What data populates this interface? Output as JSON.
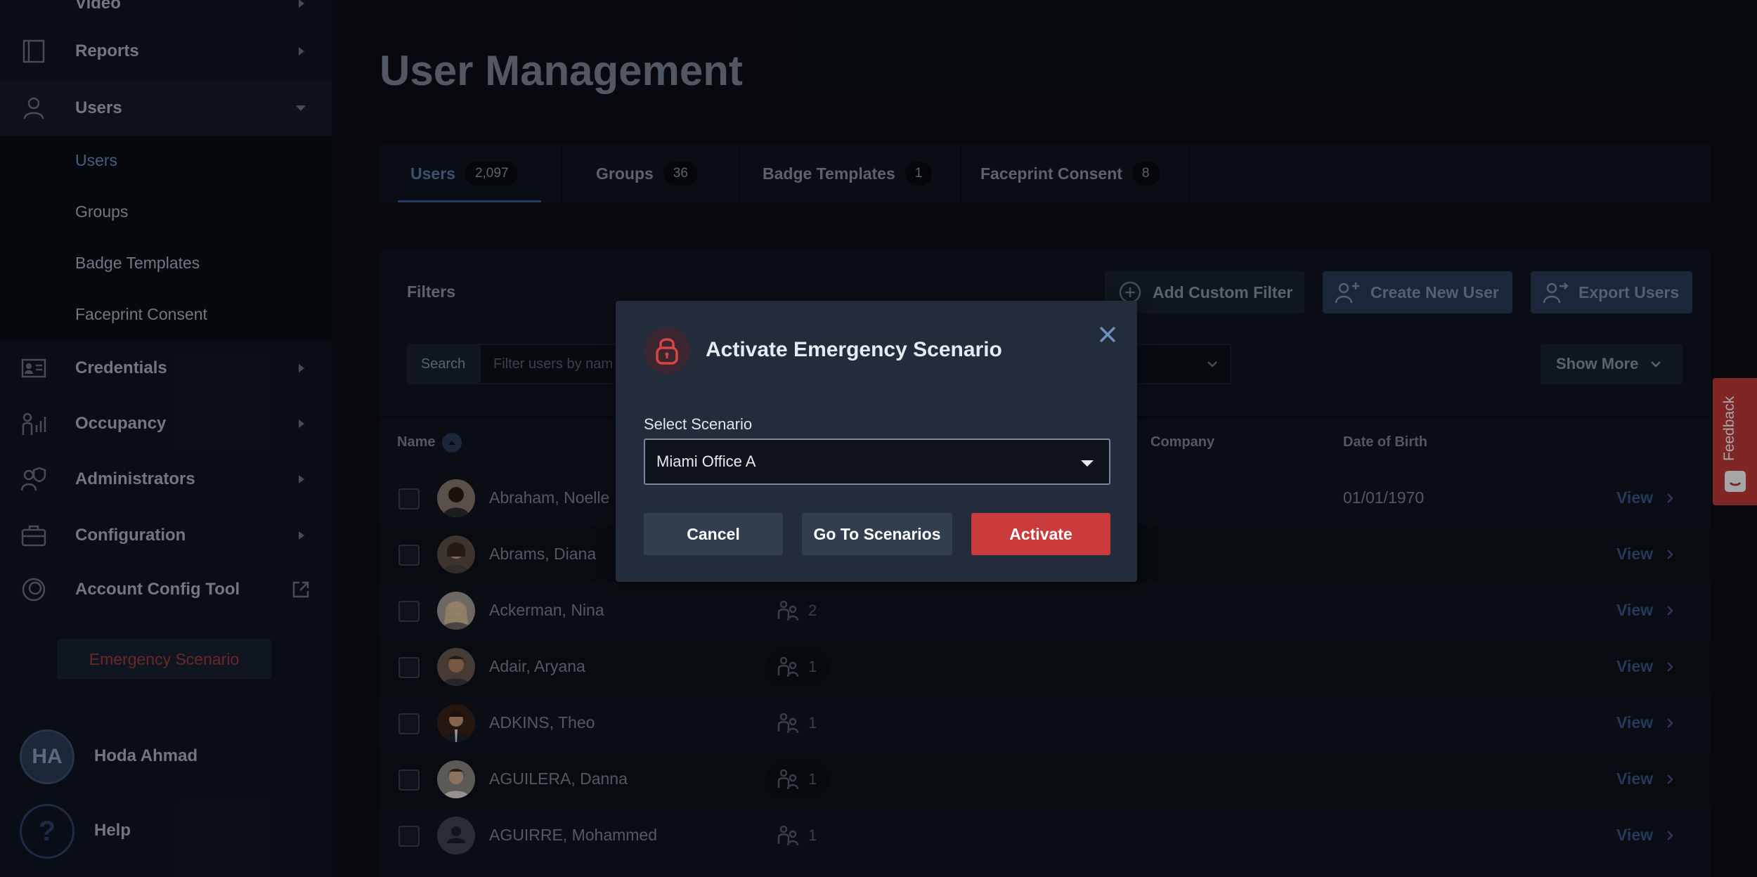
{
  "sidebar": {
    "top_partial_label": "Video",
    "items": [
      {
        "label": "Reports",
        "icon": "book-icon"
      },
      {
        "label": "Users",
        "icon": "person-icon",
        "expanded": true
      },
      {
        "label": "Credentials",
        "icon": "id-card-icon"
      },
      {
        "label": "Occupancy",
        "icon": "occupancy-icon"
      },
      {
        "label": "Administrators",
        "icon": "admin-shield-icon"
      },
      {
        "label": "Configuration",
        "icon": "briefcase-icon"
      },
      {
        "label": "Account Config Tool",
        "icon": "config-tool-icon"
      }
    ],
    "sub_items": [
      {
        "label": "Users",
        "active": true
      },
      {
        "label": "Groups"
      },
      {
        "label": "Badge Templates"
      },
      {
        "label": "Faceprint Consent"
      }
    ],
    "emergency_button": "Emergency Scenario",
    "user": {
      "initials": "HA",
      "name": "Hoda Ahmad"
    },
    "help": {
      "glyph": "?",
      "label": "Help"
    }
  },
  "page": {
    "title": "User Management"
  },
  "tabs": [
    {
      "label": "Users",
      "count": "2,097",
      "active": true
    },
    {
      "label": "Groups",
      "count": "36"
    },
    {
      "label": "Badge Templates",
      "count": "1"
    },
    {
      "label": "Faceprint Consent",
      "count": "8"
    }
  ],
  "filters": {
    "label": "Filters",
    "add_custom_filter": "Add Custom Filter",
    "create_new_user": "Create New User",
    "export_users": "Export Users",
    "search_label": "Search",
    "search_placeholder": "Filter users by nam",
    "show_more": "Show More"
  },
  "table": {
    "columns": {
      "name": "Name",
      "company": "Company",
      "dob": "Date of Birth"
    },
    "view_label": "View",
    "rows": [
      {
        "name": "Abraham, Noelle",
        "groups": "",
        "dob": "01/01/1970"
      },
      {
        "name": "Abrams, Diana",
        "groups": "",
        "dob": ""
      },
      {
        "name": "Ackerman, Nina",
        "groups": "2",
        "dob": ""
      },
      {
        "name": "Adair, Aryana",
        "groups": "1",
        "dob": ""
      },
      {
        "name": "ADKINS, Theo",
        "groups": "1",
        "dob": ""
      },
      {
        "name": "AGUILERA, Danna",
        "groups": "1",
        "dob": ""
      },
      {
        "name": "AGUIRRE, Mohammed",
        "groups": "1",
        "dob": ""
      }
    ]
  },
  "modal": {
    "title": "Activate Emergency Scenario",
    "select_label": "Select Scenario",
    "selected_value": "Miami Office A",
    "cancel": "Cancel",
    "go_to_scenarios": "Go To Scenarios",
    "activate": "Activate"
  },
  "feedback": {
    "label": "Feedback"
  },
  "colors": {
    "accent_blue": "#3b5b99",
    "danger_red": "#cc3b3b",
    "modal_bg": "#232c3b",
    "sidebar_bg": "#0f1521"
  }
}
